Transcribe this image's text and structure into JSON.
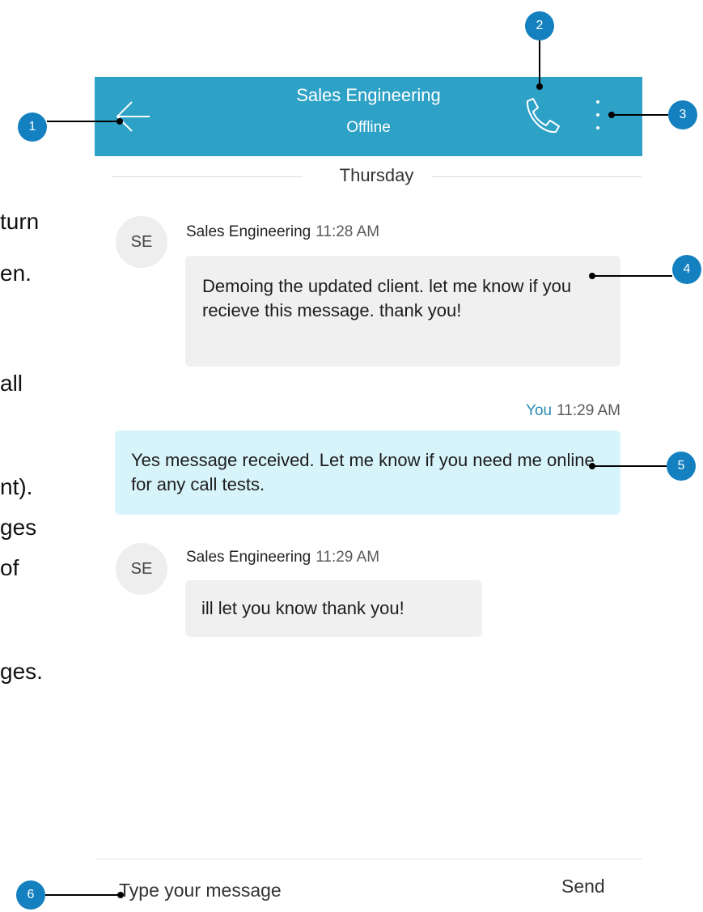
{
  "side_text": [
    "turn",
    "en.",
    "all",
    "nt).",
    "ges",
    "of",
    "ges."
  ],
  "header": {
    "title": "Sales Engineering",
    "status": "Offline",
    "back_icon": "arrow-left-icon",
    "call_icon": "phone-icon",
    "more_icon": "more-vertical-icon",
    "background": "#2ea1c7"
  },
  "day_separator": "Thursday",
  "messages": [
    {
      "avatar": "SE",
      "sender": "Sales Engineering",
      "time": "11:28 AM",
      "text": "Demoing the updated client. let me know if you recieve this message. thank you!"
    },
    {
      "sender": "You",
      "time": "11:29 AM",
      "text": "Yes message received. Let me know if you need me online for any call tests."
    },
    {
      "avatar": "SE",
      "sender": "Sales Engineering",
      "time": "11:29 AM",
      "text": "ill let you know thank you!"
    }
  ],
  "composer": {
    "placeholder": "Type your message",
    "send_label": "Send"
  },
  "callouts": [
    "1",
    "2",
    "3",
    "4",
    "5",
    "6"
  ],
  "colors": {
    "callout": "#1580bf",
    "own_bubble": "#d8f4fb",
    "other_bubble": "#f0f0f0"
  }
}
